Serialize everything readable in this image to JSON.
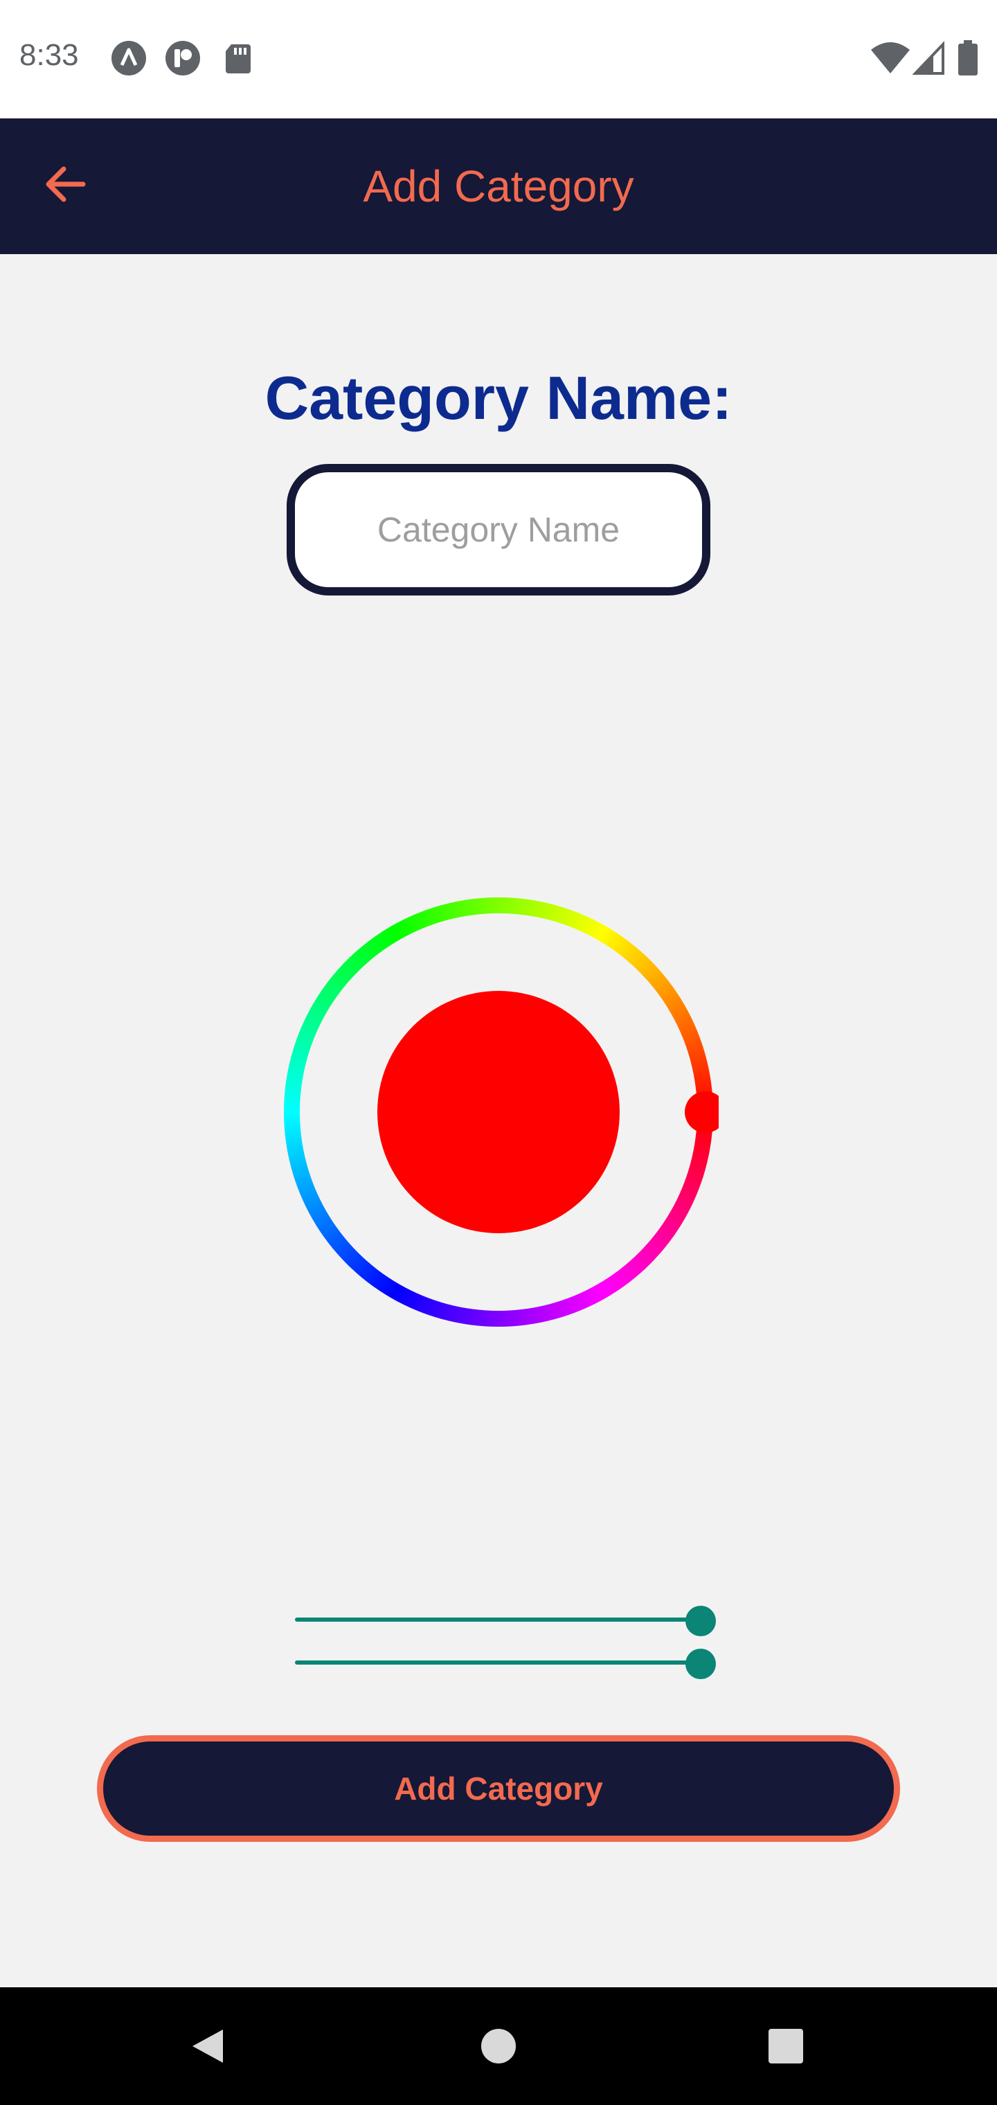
{
  "status_bar": {
    "time": "8:33",
    "left_icons": [
      "app-a-icon",
      "app-p-icon",
      "sd-card-icon"
    ],
    "right_icons": [
      "wifi-icon",
      "cellular-signal-icon",
      "battery-icon"
    ]
  },
  "app_bar": {
    "back_icon": "arrow-left-icon",
    "title": "Add Category"
  },
  "form": {
    "name_label": "Category Name:",
    "name_placeholder": "Category Name",
    "name_value": ""
  },
  "color_picker": {
    "selected_color": "#ff0000",
    "hue_degrees": 0,
    "slider_1_value": 1.0,
    "slider_2_value": 1.0
  },
  "actions": {
    "add_label": "Add Category"
  },
  "colors": {
    "app_bar_bg": "#151836",
    "accent": "#f26a4f",
    "title_blue": "#0d2b8f",
    "slider_teal": "#0a8576",
    "page_bg": "#f2f2f2"
  },
  "nav_bar": {
    "icons": [
      "back-triangle-icon",
      "home-circle-icon",
      "recents-square-icon"
    ]
  }
}
